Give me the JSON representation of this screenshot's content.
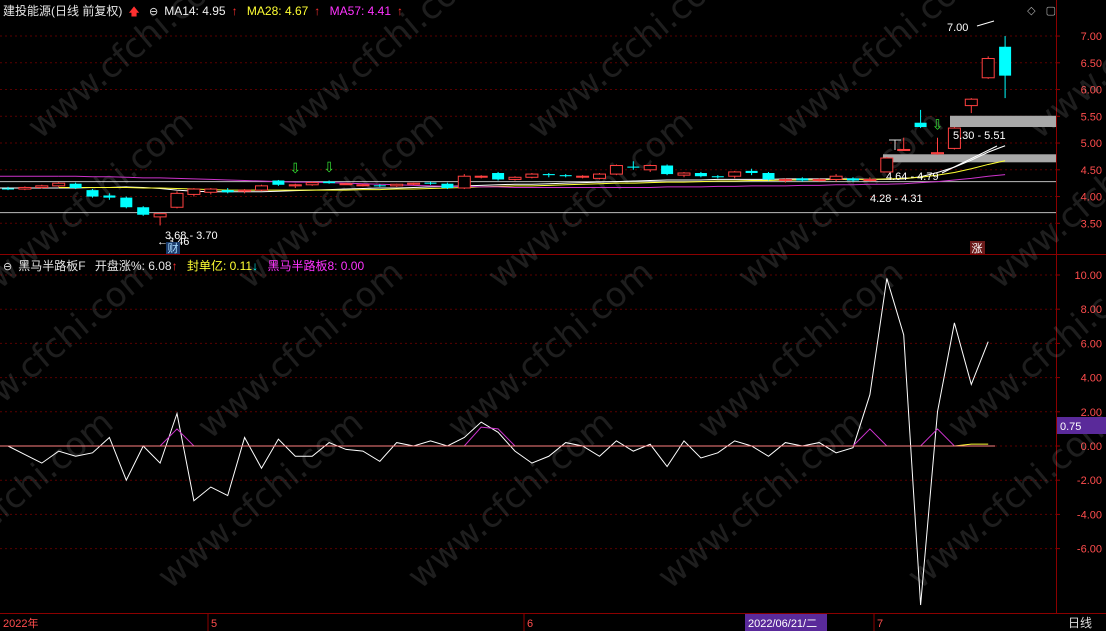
{
  "header_top": {
    "title": "建投能源(日线 前复权)",
    "ma14_label": "MA14: 4.95",
    "ma28_label": "MA28: 4.67",
    "ma57_label": "MA57: 4.41"
  },
  "header_bottom": {
    "indicator_name": "黑马半路板F",
    "open_pct_label": "开盘涨%: 6.08",
    "seal_label": "封单亿: 0.11",
    "line8_label": "黑马半路板8: 0.00"
  },
  "bottom_axis": {
    "year_label": "2022年",
    "month5": "5",
    "month6": "6",
    "cursor_date": "2022/06/21/二",
    "month7": "7",
    "period_button": "日线"
  },
  "annotations": {
    "max_label": "7.00",
    "min_label": "3.68 - 3.70",
    "min_arrow": "3.46",
    "band1": "5.30 - 5.51",
    "band2": "4.64 - 4.79",
    "band3": "4.28 - 4.31",
    "fin_tag": "财",
    "zhang_tag": "涨",
    "osc_value_tag": "0.75"
  },
  "colors": {
    "up": "#ff4040",
    "down": "#00ffff",
    "ma14": "#ffffff",
    "ma28": "#ffff33",
    "ma57": "#cc33cc",
    "grid": "#5a0000",
    "axis": "#8b0000"
  },
  "chart_data": [
    {
      "type": "candlestick",
      "title": "建投能源(日线 前复权)",
      "ylim": [
        3.3,
        7.3
      ],
      "price_ticks": [
        "7.00",
        "6.50",
        "6.00",
        "5.50",
        "5.00",
        "4.50",
        "4.00",
        "3.50"
      ],
      "series": [
        {
          "name": "MA14",
          "values": [
            4.16,
            4.16,
            4.17,
            4.17,
            4.18,
            4.17,
            4.15,
            4.12,
            4.1,
            4.09,
            4.09,
            4.09,
            4.09,
            4.1,
            4.11,
            4.12,
            4.13,
            4.14,
            4.15,
            4.16,
            4.16,
            4.17,
            4.18,
            4.19,
            4.2,
            4.21,
            4.22,
            4.23,
            4.23,
            4.24,
            4.25,
            4.26,
            4.27,
            4.28,
            4.29,
            4.3,
            4.31,
            4.31,
            4.31,
            4.32,
            4.32,
            4.32,
            4.32,
            4.33,
            4.33,
            4.33,
            4.33,
            4.33,
            4.32,
            4.32,
            4.33,
            4.37,
            4.45,
            4.55,
            4.68,
            4.83,
            4.95
          ]
        },
        {
          "name": "MA28",
          "values": [
            4.17,
            4.17,
            4.17,
            4.17,
            4.17,
            4.16,
            4.16,
            4.15,
            4.14,
            4.13,
            4.12,
            4.12,
            4.12,
            4.12,
            4.12,
            4.12,
            4.12,
            4.12,
            4.13,
            4.13,
            4.14,
            4.14,
            4.15,
            4.16,
            4.17,
            4.18,
            4.19,
            4.2,
            4.2,
            4.21,
            4.22,
            4.23,
            4.24,
            4.25,
            4.25,
            4.26,
            4.27,
            4.27,
            4.28,
            4.29,
            4.29,
            4.3,
            4.3,
            4.31,
            4.31,
            4.31,
            4.32,
            4.32,
            4.32,
            4.33,
            4.34,
            4.36,
            4.4,
            4.45,
            4.52,
            4.6,
            4.67
          ]
        },
        {
          "name": "MA57",
          "values": [
            4.38,
            4.38,
            4.37,
            4.37,
            4.36,
            4.35,
            4.35,
            4.34,
            4.33,
            4.32,
            4.31,
            4.3,
            4.29,
            4.28,
            4.27,
            4.27,
            4.26,
            4.25,
            4.24,
            4.23,
            4.22,
            4.21,
            4.2,
            4.19,
            4.19,
            4.18,
            4.18,
            4.17,
            4.17,
            4.17,
            4.17,
            4.17,
            4.17,
            4.17,
            4.17,
            4.17,
            4.18,
            4.18,
            4.18,
            4.19,
            4.19,
            4.2,
            4.2,
            4.2,
            4.21,
            4.21,
            4.22,
            4.22,
            4.23,
            4.23,
            4.24,
            4.26,
            4.28,
            4.31,
            4.34,
            4.38,
            4.41
          ]
        }
      ],
      "candles": [
        {
          "o": 4.15,
          "h": 4.18,
          "l": 4.12,
          "c": 4.14
        },
        {
          "o": 4.14,
          "h": 4.19,
          "l": 4.12,
          "c": 4.17
        },
        {
          "o": 4.17,
          "h": 4.22,
          "l": 4.15,
          "c": 4.2
        },
        {
          "o": 4.2,
          "h": 4.27,
          "l": 4.18,
          "c": 4.25
        },
        {
          "o": 4.24,
          "h": 4.26,
          "l": 4.14,
          "c": 4.16
        },
        {
          "o": 4.12,
          "h": 4.14,
          "l": 3.98,
          "c": 4.0
        },
        {
          "o": 4.02,
          "h": 4.06,
          "l": 3.94,
          "c": 3.98
        },
        {
          "o": 3.98,
          "h": 4.0,
          "l": 3.78,
          "c": 3.8
        },
        {
          "o": 3.8,
          "h": 3.82,
          "l": 3.64,
          "c": 3.66
        },
        {
          "o": 3.62,
          "h": 3.68,
          "l": 3.46,
          "c": 3.68
        },
        {
          "o": 3.8,
          "h": 4.1,
          "l": 3.78,
          "c": 4.06
        },
        {
          "o": 4.04,
          "h": 4.16,
          "l": 4.0,
          "c": 4.14
        },
        {
          "o": 4.08,
          "h": 4.16,
          "l": 4.04,
          "c": 4.14
        },
        {
          "o": 4.12,
          "h": 4.16,
          "l": 4.06,
          "c": 4.08
        },
        {
          "o": 4.1,
          "h": 4.14,
          "l": 4.06,
          "c": 4.12
        },
        {
          "o": 4.12,
          "h": 4.22,
          "l": 4.1,
          "c": 4.2
        },
        {
          "o": 4.3,
          "h": 4.31,
          "l": 4.2,
          "c": 4.22
        },
        {
          "o": 4.2,
          "h": 4.24,
          "l": 4.16,
          "c": 4.22
        },
        {
          "o": 4.22,
          "h": 4.28,
          "l": 4.2,
          "c": 4.26
        },
        {
          "o": 4.28,
          "h": 4.3,
          "l": 4.24,
          "c": 4.25
        },
        {
          "o": 4.24,
          "h": 4.26,
          "l": 4.22,
          "c": 4.24
        },
        {
          "o": 4.22,
          "h": 4.24,
          "l": 4.19,
          "c": 4.22
        },
        {
          "o": 4.21,
          "h": 4.23,
          "l": 4.18,
          "c": 4.2
        },
        {
          "o": 4.2,
          "h": 4.24,
          "l": 4.18,
          "c": 4.23
        },
        {
          "o": 4.23,
          "h": 4.26,
          "l": 4.21,
          "c": 4.25
        },
        {
          "o": 4.26,
          "h": 4.28,
          "l": 4.22,
          "c": 4.24
        },
        {
          "o": 4.24,
          "h": 4.26,
          "l": 4.14,
          "c": 4.16
        },
        {
          "o": 4.16,
          "h": 4.42,
          "l": 4.14,
          "c": 4.38
        },
        {
          "o": 4.38,
          "h": 4.4,
          "l": 4.34,
          "c": 4.38
        },
        {
          "o": 4.44,
          "h": 4.46,
          "l": 4.3,
          "c": 4.32
        },
        {
          "o": 4.32,
          "h": 4.38,
          "l": 4.3,
          "c": 4.36
        },
        {
          "o": 4.36,
          "h": 4.44,
          "l": 4.34,
          "c": 4.42
        },
        {
          "o": 4.42,
          "h": 4.44,
          "l": 4.36,
          "c": 4.4
        },
        {
          "o": 4.4,
          "h": 4.42,
          "l": 4.36,
          "c": 4.38
        },
        {
          "o": 4.38,
          "h": 4.4,
          "l": 4.34,
          "c": 4.38
        },
        {
          "o": 4.34,
          "h": 4.44,
          "l": 4.32,
          "c": 4.42
        },
        {
          "o": 4.42,
          "h": 4.6,
          "l": 4.4,
          "c": 4.58
        },
        {
          "o": 4.56,
          "h": 4.66,
          "l": 4.5,
          "c": 4.54
        },
        {
          "o": 4.5,
          "h": 4.6,
          "l": 4.46,
          "c": 4.58
        },
        {
          "o": 4.58,
          "h": 4.6,
          "l": 4.4,
          "c": 4.42
        },
        {
          "o": 4.4,
          "h": 4.46,
          "l": 4.36,
          "c": 4.44
        },
        {
          "o": 4.44,
          "h": 4.46,
          "l": 4.36,
          "c": 4.38
        },
        {
          "o": 4.38,
          "h": 4.4,
          "l": 4.34,
          "c": 4.36
        },
        {
          "o": 4.38,
          "h": 4.48,
          "l": 4.34,
          "c": 4.46
        },
        {
          "o": 4.48,
          "h": 4.52,
          "l": 4.4,
          "c": 4.44
        },
        {
          "o": 4.44,
          "h": 4.46,
          "l": 4.3,
          "c": 4.32
        },
        {
          "o": 4.3,
          "h": 4.34,
          "l": 4.26,
          "c": 4.32
        },
        {
          "o": 4.34,
          "h": 4.36,
          "l": 4.28,
          "c": 4.3
        },
        {
          "o": 4.3,
          "h": 4.34,
          "l": 4.28,
          "c": 4.32
        },
        {
          "o": 4.32,
          "h": 4.42,
          "l": 4.28,
          "c": 4.38
        },
        {
          "o": 4.34,
          "h": 4.36,
          "l": 4.28,
          "c": 4.3
        },
        {
          "o": 4.3,
          "h": 4.36,
          "l": 4.28,
          "c": 4.32
        },
        {
          "o": 4.46,
          "h": 4.74,
          "l": 4.46,
          "c": 4.72
        },
        {
          "o": 4.88,
          "h": 5.1,
          "l": 4.86,
          "c": 4.88
        },
        {
          "o": 5.38,
          "h": 5.62,
          "l": 5.28,
          "c": 5.3
        },
        {
          "o": 4.8,
          "h": 5.1,
          "l": 4.78,
          "c": 4.82
        },
        {
          "o": 4.9,
          "h": 5.3,
          "l": 4.88,
          "c": 5.28
        },
        {
          "o": 5.7,
          "h": 5.84,
          "l": 5.56,
          "c": 5.82
        },
        {
          "o": 6.22,
          "h": 6.62,
          "l": 6.2,
          "c": 6.58
        },
        {
          "o": 6.8,
          "h": 7.0,
          "l": 5.84,
          "c": 6.26
        }
      ]
    },
    {
      "type": "line",
      "title": "黑马半路板F",
      "ylim": [
        -9.5,
        10.5
      ],
      "ticks": [
        "10.00",
        "8.00",
        "6.00",
        "4.00",
        "2.00",
        "0.00",
        "-2.00",
        "-4.00",
        "-6.00"
      ],
      "series": [
        {
          "name": "开盘涨%",
          "values": [
            0,
            -0.5,
            -1.0,
            -0.3,
            -0.6,
            -0.4,
            0.5,
            -2.0,
            0,
            -1.0,
            1.9,
            -3.2,
            -2.4,
            -2.9,
            0.5,
            -1.3,
            0.4,
            -0.6,
            -0.6,
            0.2,
            -0.2,
            -0.3,
            -0.9,
            0.2,
            0,
            0.3,
            0,
            0.5,
            1.4,
            0.8,
            -0.3,
            -1.0,
            -0.6,
            0.2,
            0,
            -0.6,
            0.3,
            -0.3,
            0.1,
            -1.2,
            0.3,
            -0.7,
            -0.4,
            0.3,
            0,
            -0.6,
            0.2,
            0,
            0.2,
            -0.4,
            -0.1,
            3.0,
            9.8,
            6.5,
            -9.3,
            2.0,
            7.2,
            3.6,
            6.1
          ]
        },
        {
          "name": "封单亿",
          "values": [
            0,
            0,
            0,
            0,
            0,
            0,
            0,
            0,
            0,
            0,
            0,
            0,
            0,
            0,
            0,
            0,
            0,
            0,
            0,
            0,
            0,
            0,
            0,
            0,
            0,
            0,
            0,
            0,
            0,
            0,
            0,
            0,
            0,
            0,
            0,
            0,
            0,
            0,
            0,
            0,
            0,
            0,
            0,
            0,
            0,
            0,
            0,
            0,
            0,
            0,
            0,
            0,
            0,
            0,
            0,
            0,
            0,
            0.11,
            0.11
          ]
        },
        {
          "name": "黑马半路板8",
          "values": [
            0,
            0,
            0,
            0,
            0,
            0,
            0,
            0,
            0,
            0,
            1.0,
            0,
            0,
            0,
            0,
            0,
            0,
            0,
            0,
            0,
            0,
            0,
            0,
            0,
            0,
            0,
            0,
            0,
            1.1,
            1.0,
            0,
            0,
            0,
            0,
            0,
            0,
            0,
            0,
            0,
            0,
            0,
            0,
            0,
            0,
            0,
            0,
            0,
            0,
            0,
            0,
            0,
            1.0,
            0,
            0,
            0,
            1.0,
            0,
            0,
            0
          ]
        }
      ]
    }
  ]
}
